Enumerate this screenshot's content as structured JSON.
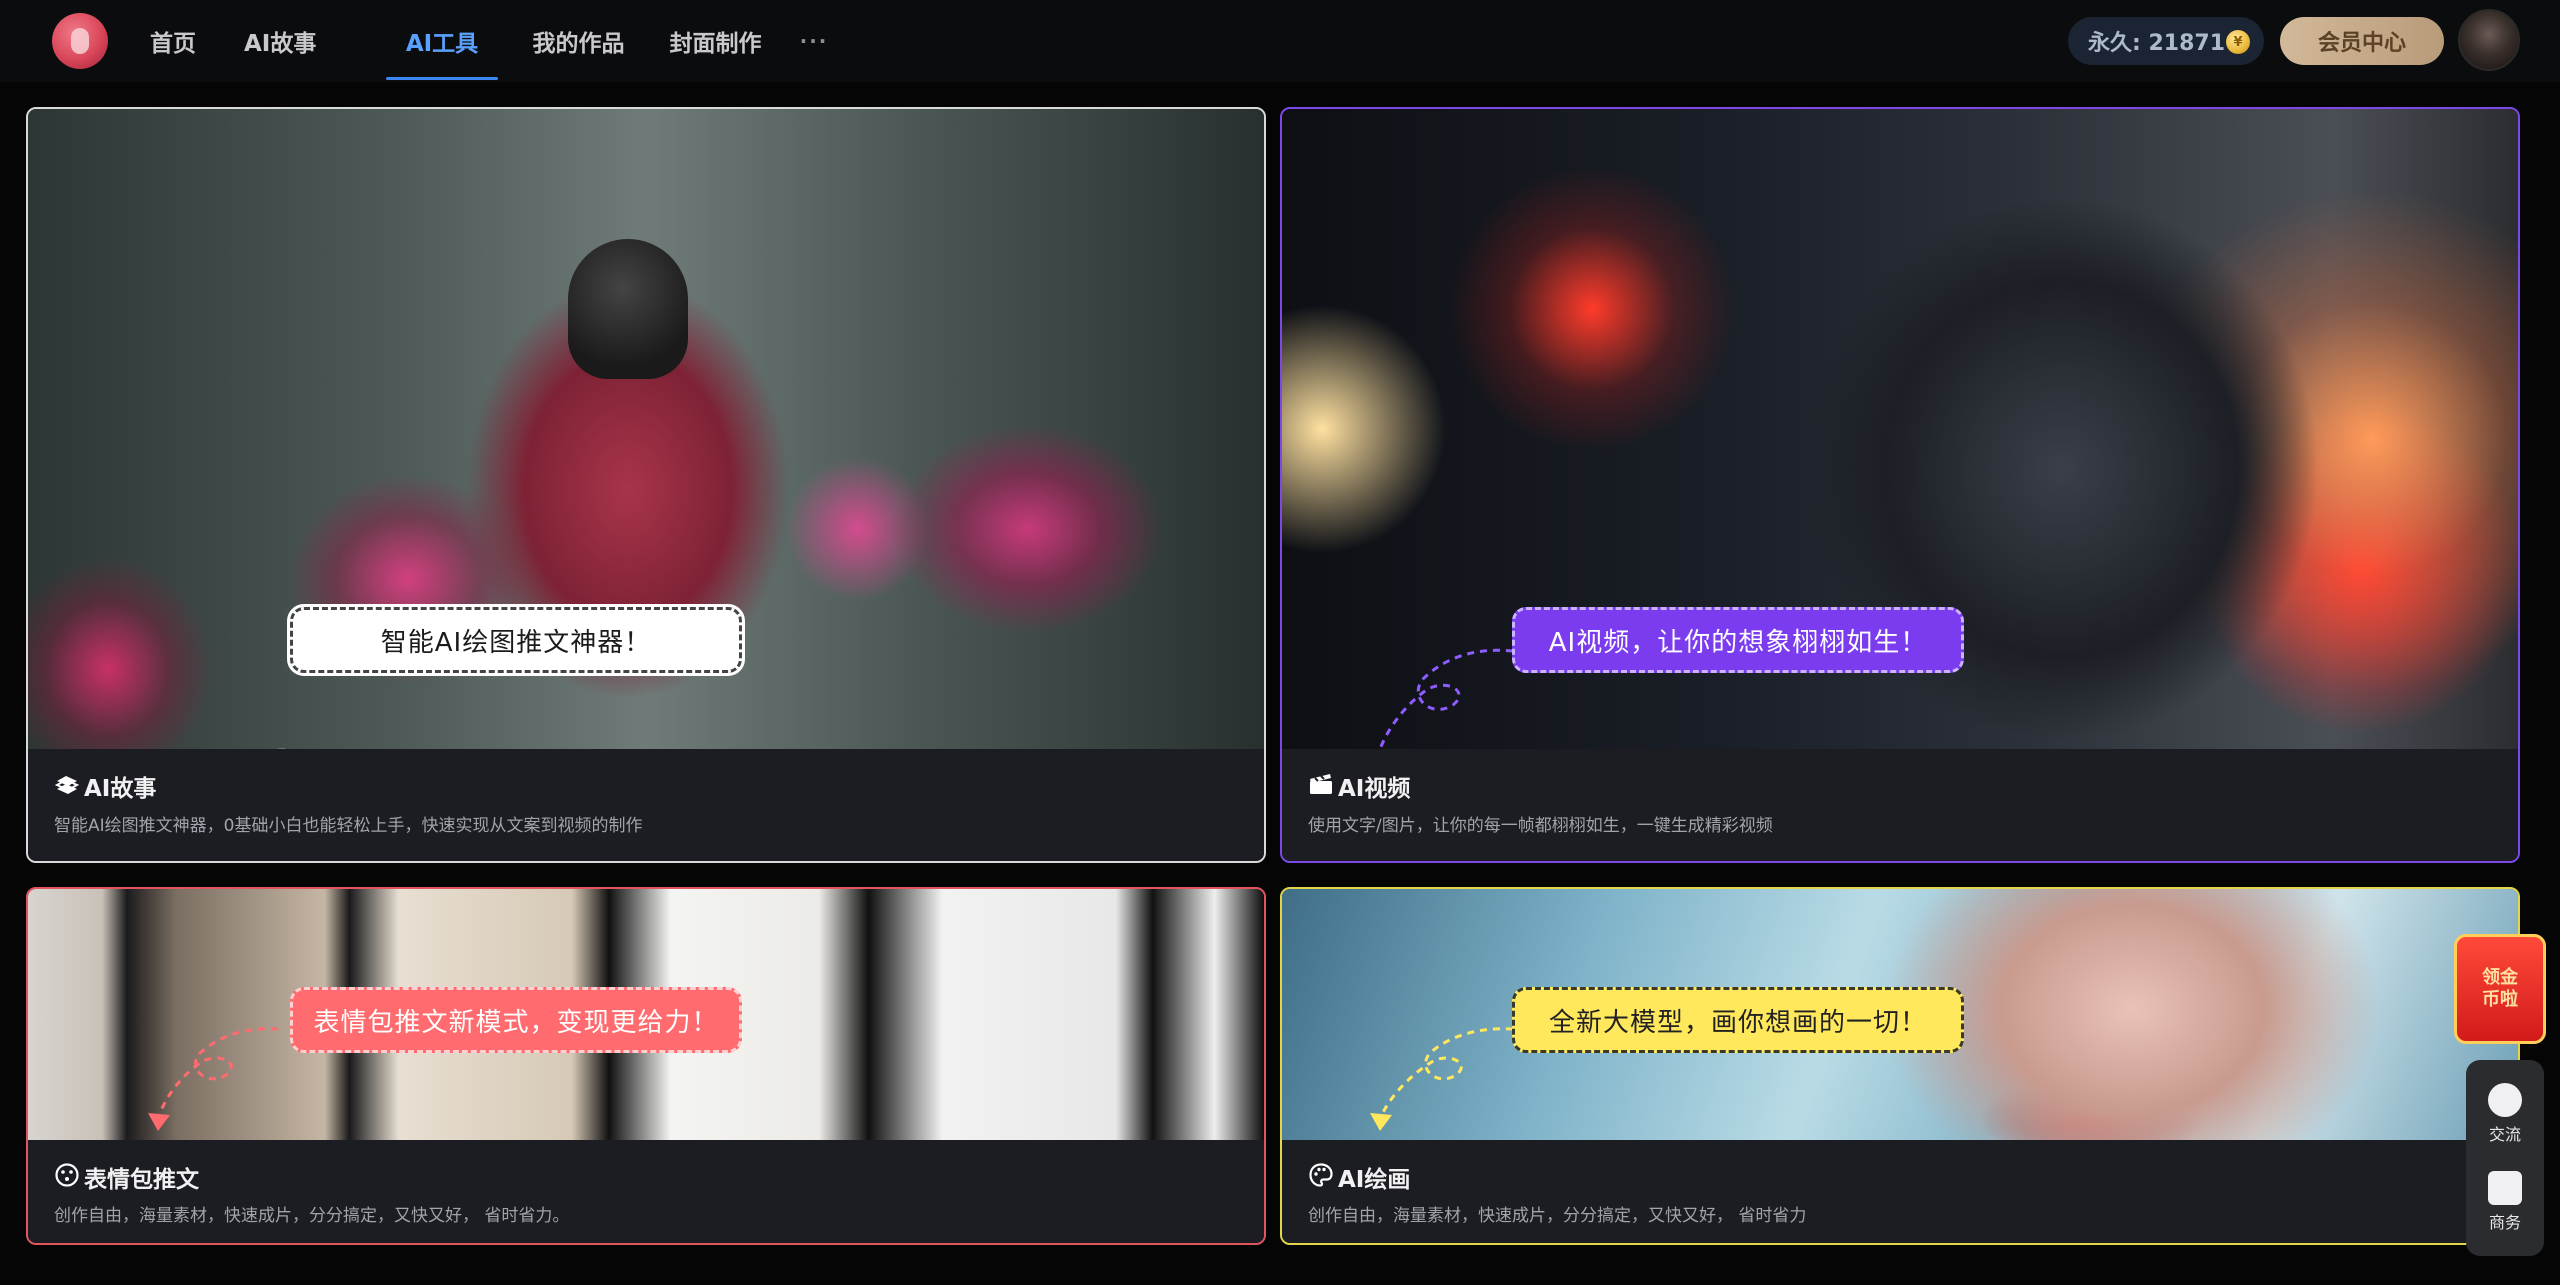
{
  "nav": {
    "items": [
      "首页",
      "AI故事",
      "AI工具",
      "我的作品",
      "封面制作",
      "···"
    ],
    "active": "AI工具"
  },
  "account": {
    "coins_label": "永久: 21871",
    "vip_label": "会员中心"
  },
  "cards": [
    {
      "title": "AI故事",
      "icon": "book-icon",
      "description": "智能AI绘图推文神器，0基础小白也能轻松上手，快速实现从文案到视频的制作",
      "bubble": "智能AI绘图推文神器！",
      "border_color": "#d9d9dc"
    },
    {
      "title": "AI视频",
      "icon": "clapperboard-icon",
      "description": "使用文字/图片，让你的每一帧都栩栩如生，一键生成精彩视频",
      "bubble": "AI视频，让你的想象栩栩如生！",
      "border_color": "#7c48e8"
    },
    {
      "title": "表情包推文",
      "icon": "smiley-icon",
      "description": "创作自由，海量素材，快速成片，分分搞定，又快又好， 省时省力。",
      "bubble": "表情包推文新模式，变现更给力！",
      "border_color": "#e2555f"
    },
    {
      "title": "AI绘画",
      "icon": "palette-icon",
      "description": "创作自由，海量素材，快速成片，分分搞定，又快又好， 省时省力",
      "bubble": "全新大模型，画你想画的一切！",
      "border_color": "#e3d54a"
    }
  ],
  "floating": {
    "promo_lines": [
      "领金",
      "币啦"
    ],
    "side_items": [
      "交流",
      "商务"
    ]
  }
}
